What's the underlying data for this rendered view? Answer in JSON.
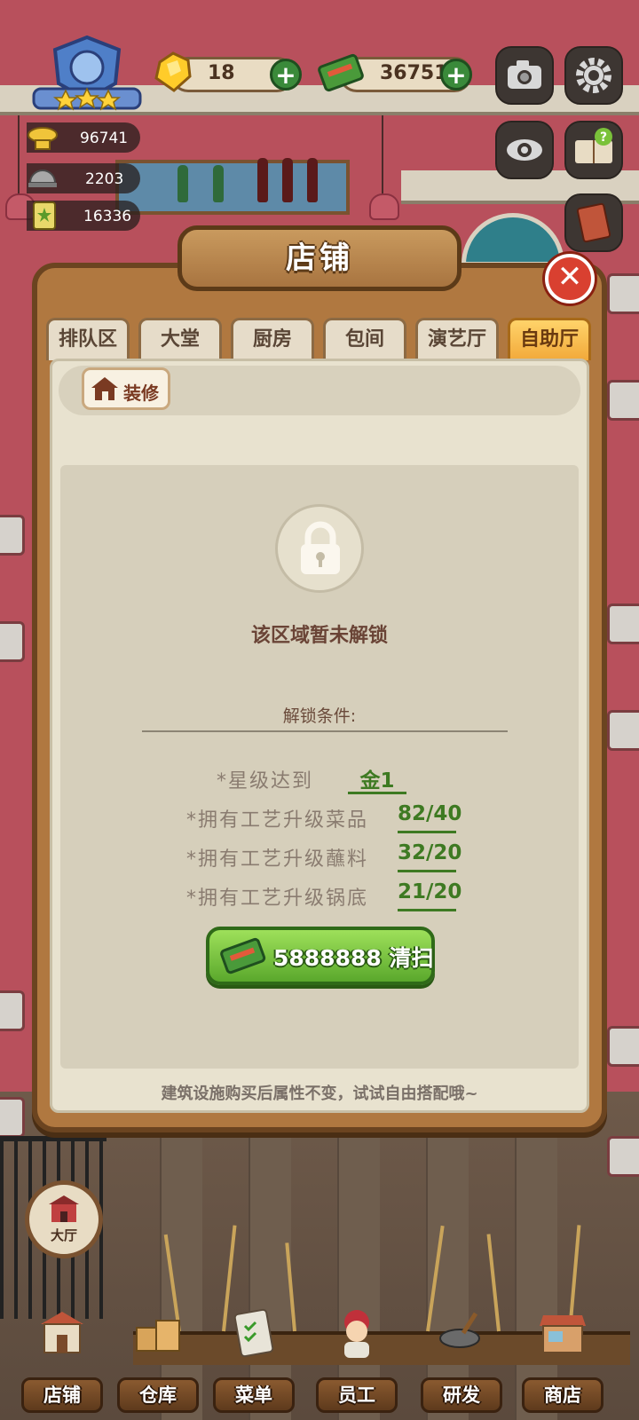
{
  "hud": {
    "gems": "18",
    "cash": "36751",
    "stats": [
      "96741",
      "2203",
      "16336"
    ]
  },
  "panel": {
    "title": "店铺",
    "tabs": [
      {
        "label": "排队区",
        "active": false
      },
      {
        "label": "大堂",
        "active": false
      },
      {
        "label": "厨房",
        "active": false
      },
      {
        "label": "包间",
        "active": false
      },
      {
        "label": "演艺厅",
        "active": false
      },
      {
        "label": "自助厅",
        "active": true
      }
    ],
    "decorate_label": "装修",
    "locked_text": "该区域暂未解锁",
    "conditions_title": "解锁条件:",
    "requirements": [
      {
        "label": "*星级达到",
        "value": "金1"
      },
      {
        "label": "*拥有工艺升级菜品",
        "value": "82/40"
      },
      {
        "label": "*拥有工艺升级蘸料",
        "value": "32/20"
      },
      {
        "label": "*拥有工艺升级锅底",
        "value": "21/20"
      }
    ],
    "clear_button": "5888888 清扫",
    "footer_tip": "建筑设施购买后属性不变，试试自由搭配哦~"
  },
  "hall_button": "大厅",
  "nav": [
    "店铺",
    "仓库",
    "菜单",
    "员工",
    "研发",
    "商店"
  ],
  "colors": {
    "accent_green": "#3e7a22",
    "active_tab": "#f2a93a",
    "close_red": "#d94030"
  }
}
